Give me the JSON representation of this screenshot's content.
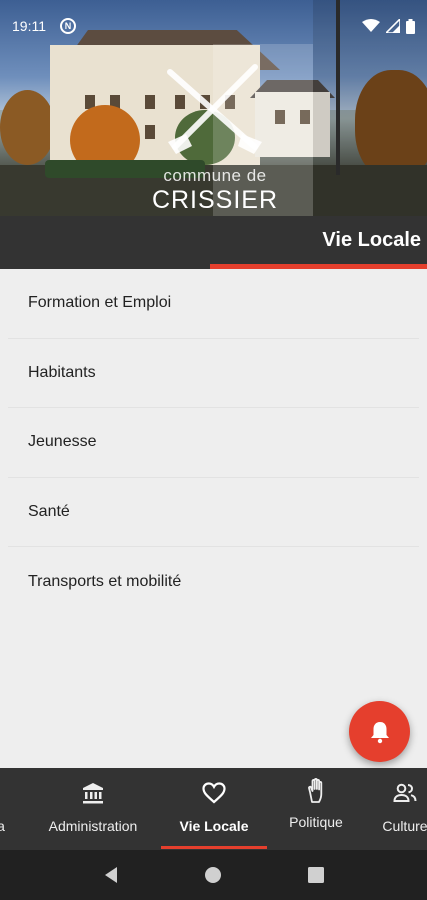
{
  "status_bar": {
    "time": "19:11",
    "nfc_glyph": "N",
    "icons": [
      "wifi-icon",
      "signal-icon",
      "battery-icon"
    ]
  },
  "header": {
    "logo_line1": "commune de",
    "logo_line2": "CRISSIER",
    "section_title": "Vie Locale"
  },
  "list": {
    "items": [
      {
        "label": "Formation et Emploi"
      },
      {
        "label": "Habitants"
      },
      {
        "label": "Jeunesse"
      },
      {
        "label": "Santé"
      },
      {
        "label": "Transports et mobilité"
      }
    ]
  },
  "fab": {
    "icon": "bell-icon"
  },
  "bottom_nav": {
    "items": [
      {
        "label": "a",
        "icon": ""
      },
      {
        "label": "Administration",
        "icon": "bank-icon"
      },
      {
        "label": "Vie Locale",
        "icon": "heart-icon",
        "active": true
      },
      {
        "label": "Politique",
        "icon": "hand-icon"
      },
      {
        "label": "Culture",
        "icon": "people-icon"
      }
    ]
  },
  "colors": {
    "accent": "#e53f2d",
    "bar_background": "#333333",
    "list_background": "#eeeeee",
    "system_nav": "#212121"
  }
}
